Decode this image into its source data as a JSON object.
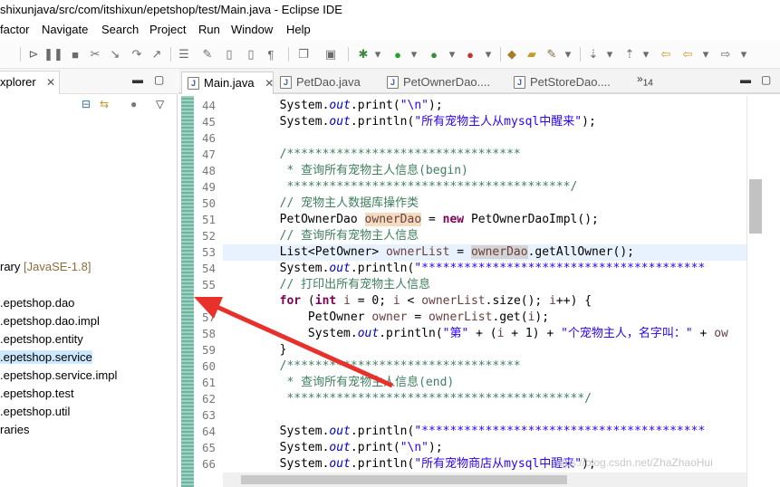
{
  "window": {
    "title": "shixunjava/src/com/itshixun/epetshop/test/Main.java - Eclipse IDE"
  },
  "menu": [
    "factor",
    "Navigate",
    "Search",
    "Project",
    "Run",
    "Window",
    "Help"
  ],
  "left_panel": {
    "tab_label": "xplorer",
    "items": [
      {
        "label": "rary",
        "suffix": "[JavaSE-1.8]"
      },
      {
        "label": ".epetshop.dao"
      },
      {
        "label": ".epetshop.dao.impl"
      },
      {
        "label": ".epetshop.entity"
      },
      {
        "label": ".epetshop.service"
      },
      {
        "label": ".epetshop.service.impl"
      },
      {
        "label": ".epetshop.test"
      },
      {
        "label": ".epetshop.util"
      },
      {
        "label": "raries"
      }
    ]
  },
  "editor": {
    "tabs": [
      {
        "label": "Main.java",
        "active": true
      },
      {
        "label": "PetDao.java",
        "active": false
      },
      {
        "label": "PetOwnerDao....",
        "active": false
      },
      {
        "label": "PetStoreDao....",
        "active": false
      }
    ],
    "overflow": {
      "chevron": "»",
      "count": "14"
    },
    "lines": [
      {
        "n": "44",
        "parts": [
          [
            "",
            "        System."
          ],
          [
            "fld",
            "out"
          ],
          [
            "",
            ".print("
          ],
          [
            "str",
            "\"\\n\""
          ],
          [
            "",
            ");"
          ]
        ]
      },
      {
        "n": "45",
        "parts": [
          [
            "",
            "        System."
          ],
          [
            "fld",
            "out"
          ],
          [
            "",
            ".println("
          ],
          [
            "str",
            "\"所有宠物主人从mysql中醒来\""
          ],
          [
            "",
            ");"
          ]
        ]
      },
      {
        "n": "46",
        "parts": [
          [
            "",
            ""
          ]
        ]
      },
      {
        "n": "47",
        "parts": [
          [
            "cmt",
            "        /*********************************"
          ]
        ]
      },
      {
        "n": "48",
        "parts": [
          [
            "cmt",
            "         * 查询所有宠物主人信息(begin)"
          ]
        ]
      },
      {
        "n": "49",
        "parts": [
          [
            "cmt",
            "         ****************************************/"
          ]
        ]
      },
      {
        "n": "50",
        "parts": [
          [
            "cmt",
            "        // 宠物主人数据库操作类"
          ]
        ]
      },
      {
        "n": "51",
        "parts": [
          [
            "",
            "        PetOwnerDao "
          ],
          [
            "var occ",
            "ownerDao"
          ],
          [
            "",
            " = "
          ],
          [
            "kw",
            "new"
          ],
          [
            "",
            " PetOwnerDaoImpl();"
          ]
        ]
      },
      {
        "n": "52",
        "parts": [
          [
            "cmt",
            "        // 查询所有宠物主人信息"
          ]
        ]
      },
      {
        "n": "53",
        "hl": true,
        "parts": [
          [
            "",
            "        List<PetOwner> "
          ],
          [
            "var",
            "ownerList"
          ],
          [
            "",
            " = "
          ],
          [
            "var occ2",
            "ownerDao"
          ],
          [
            "",
            ".getAllOwner();"
          ]
        ]
      },
      {
        "n": "54",
        "parts": [
          [
            "",
            "        System."
          ],
          [
            "fld",
            "out"
          ],
          [
            "",
            ".println("
          ],
          [
            "str",
            "\"****************************************"
          ]
        ]
      },
      {
        "n": "55",
        "parts": [
          [
            "cmt",
            "        // 打印出所有宠物主人信息"
          ]
        ]
      },
      {
        "n": "56",
        "parts": [
          [
            "",
            "        "
          ],
          [
            "kw",
            "for"
          ],
          [
            "",
            " ("
          ],
          [
            "kw",
            "int"
          ],
          [
            "",
            " "
          ],
          [
            "var",
            "i"
          ],
          [
            "",
            " = 0; "
          ],
          [
            "var",
            "i"
          ],
          [
            "",
            " < "
          ],
          [
            "var",
            "ownerList"
          ],
          [
            "",
            ".size(); "
          ],
          [
            "var",
            "i"
          ],
          [
            "",
            "++) {"
          ]
        ]
      },
      {
        "n": "57",
        "parts": [
          [
            "",
            "            PetOwner "
          ],
          [
            "var",
            "owner"
          ],
          [
            "",
            " = "
          ],
          [
            "var",
            "ownerList"
          ],
          [
            "",
            ".get("
          ],
          [
            "var",
            "i"
          ],
          [
            "",
            ");"
          ]
        ]
      },
      {
        "n": "58",
        "parts": [
          [
            "",
            "            System."
          ],
          [
            "fld",
            "out"
          ],
          [
            "",
            ".println("
          ],
          [
            "str",
            "\"第\""
          ],
          [
            "",
            " + ("
          ],
          [
            "var",
            "i"
          ],
          [
            "",
            " + 1) + "
          ],
          [
            "str",
            "\"个宠物主人，名字叫：\""
          ],
          [
            "",
            " + "
          ],
          [
            "var",
            "ow"
          ]
        ]
      },
      {
        "n": "59",
        "parts": [
          [
            "",
            "        }"
          ]
        ]
      },
      {
        "n": "60",
        "parts": [
          [
            "cmt",
            "        /*********************************"
          ]
        ]
      },
      {
        "n": "61",
        "parts": [
          [
            "cmt",
            "         * 查询所有宠物主人信息(end)"
          ]
        ]
      },
      {
        "n": "62",
        "parts": [
          [
            "cmt",
            "         ******************************************/"
          ]
        ]
      },
      {
        "n": "63",
        "parts": [
          [
            "",
            ""
          ]
        ]
      },
      {
        "n": "64",
        "parts": [
          [
            "",
            "        System."
          ],
          [
            "fld",
            "out"
          ],
          [
            "",
            ".println("
          ],
          [
            "str",
            "\"****************************************"
          ]
        ]
      },
      {
        "n": "65",
        "parts": [
          [
            "",
            "        System."
          ],
          [
            "fld",
            "out"
          ],
          [
            "",
            ".print("
          ],
          [
            "str",
            "\"\\n\""
          ],
          [
            "",
            ");"
          ]
        ]
      },
      {
        "n": "66",
        "parts": [
          [
            "",
            "        System."
          ],
          [
            "fld",
            "out"
          ],
          [
            "",
            ".println("
          ],
          [
            "str",
            "\"所有宠物商店从mysql中醒来\""
          ],
          [
            "",
            ");"
          ]
        ]
      }
    ]
  },
  "watermark": "https://blog.csdn.net/ZhaZhaoHui",
  "colors": {
    "arrow": "#e8312a",
    "keyword": "#7f0055",
    "string": "#2a00ff",
    "comment": "#3f7f5f",
    "field": "#0000c0"
  }
}
